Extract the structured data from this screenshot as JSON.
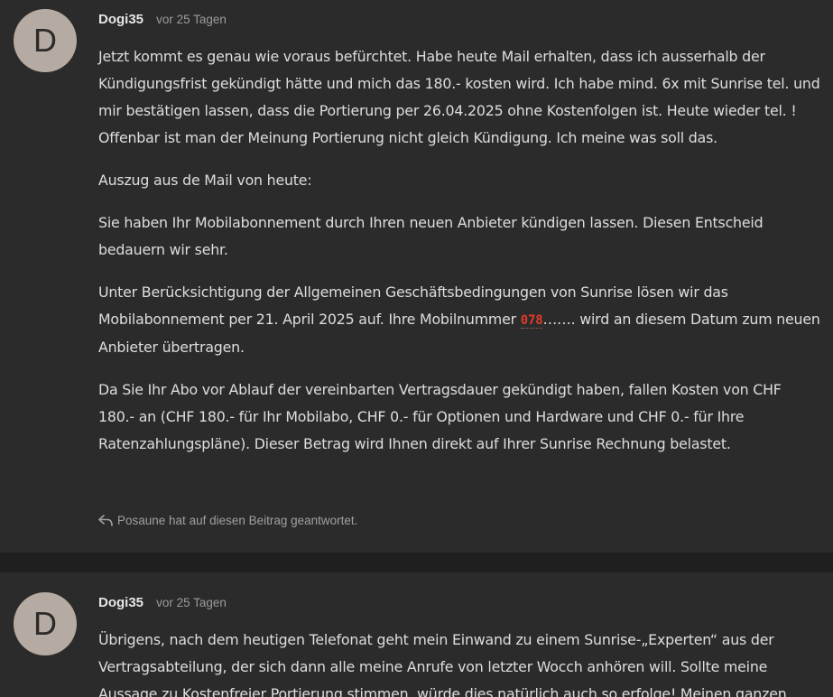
{
  "posts": [
    {
      "avatar_letter": "D",
      "username": "Dogi35",
      "timestamp": "vor 25 Tagen",
      "paragraphs": [
        "Jetzt kommt es genau wie voraus befürchtet. Habe heute Mail erhalten, dass ich ausserhalb der Kündigungsfrist gekündigt hätte und mich das 180.- kosten wird. Ich habe mind. 6x mit Sunrise tel. und mir bestätigen lassen, dass die Portierung per 26.04.2025 ohne Kostenfolgen ist. Heute wieder tel. ! Offenbar ist man der Meinung Portierung nicht gleich Kündigung. Ich meine was soll das.",
        "Auszug aus de Mail von heute:",
        "Sie haben Ihr Mobilabonnement durch Ihren neuen Anbieter kündigen lassen. Diesen Entscheid bedauern wir sehr."
      ],
      "para4_before": "Unter Berücksichtigung der Allgemeinen Geschäftsbedingungen von Sunrise lösen wir das Mobilabonnement per 21. April 2025 auf. Ihre Mobilnummer ",
      "phone_prefix": "078",
      "para4_after": "……. wird an diesem Datum zum neuen Anbieter übertragen.",
      "para5": "Da Sie Ihr Abo vor Ablauf der vereinbarten Vertragsdauer gekündigt haben, fallen Kosten von CHF 180.- an (CHF 180.- für Ihr Mobilabo, CHF 0.- für Optionen und Hardware und CHF 0.- für Ihre Ratenzahlungspläne). Dieser Betrag wird Ihnen direkt auf Ihrer Sunrise Rechnung belastet.",
      "reply_note": "Posaune hat auf diesen Beitrag geantwortet."
    },
    {
      "avatar_letter": "D",
      "username": "Dogi35",
      "timestamp": "vor 25 Tagen",
      "paragraphs": [
        "Übrigens, nach dem heutigen Telefonat geht mein Einwand zu einem Sunrise-„Experten“ aus der Vertragsabteilung, der sich dann alle meine Anrufe von letzter Wocch anhören will. Sollte meine Aussage zu Kostenfreier Portierung stimmen, würde dies natürlich auch so erfolge! Meinen ganzen"
      ]
    }
  ]
}
